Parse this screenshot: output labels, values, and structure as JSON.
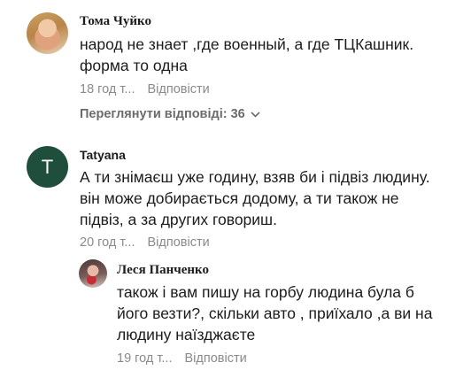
{
  "comments": [
    {
      "author": "Тома Чуйко",
      "text": "народ не знает ,где военный, а где ТЦКашник.\nформа то одна",
      "time": "18 год т...",
      "reply_label": "Відповісти",
      "view_replies": "Переглянути відповіді: 36"
    },
    {
      "author": "Tatyana",
      "avatar_letter": "T",
      "avatar_color": "#1f4e3d",
      "text": "А ти знімаєш уже годину, взяв би і підвіз людину.\nвін може добирається додому, а ти також не\nпідвіз, а за других говориш.",
      "time": "20 год т...",
      "reply_label": "Відповісти"
    },
    {
      "author": "Леся Панченко",
      "text": "також і вам пишу на горбу людина була б\nйого везти?, скільки авто , приїхало ,а ви на\nлюдину наїзджаєте",
      "time": "19 год т...",
      "reply_label": "Відповісти"
    }
  ],
  "icons": {
    "expand": "chevron-down-icon"
  }
}
